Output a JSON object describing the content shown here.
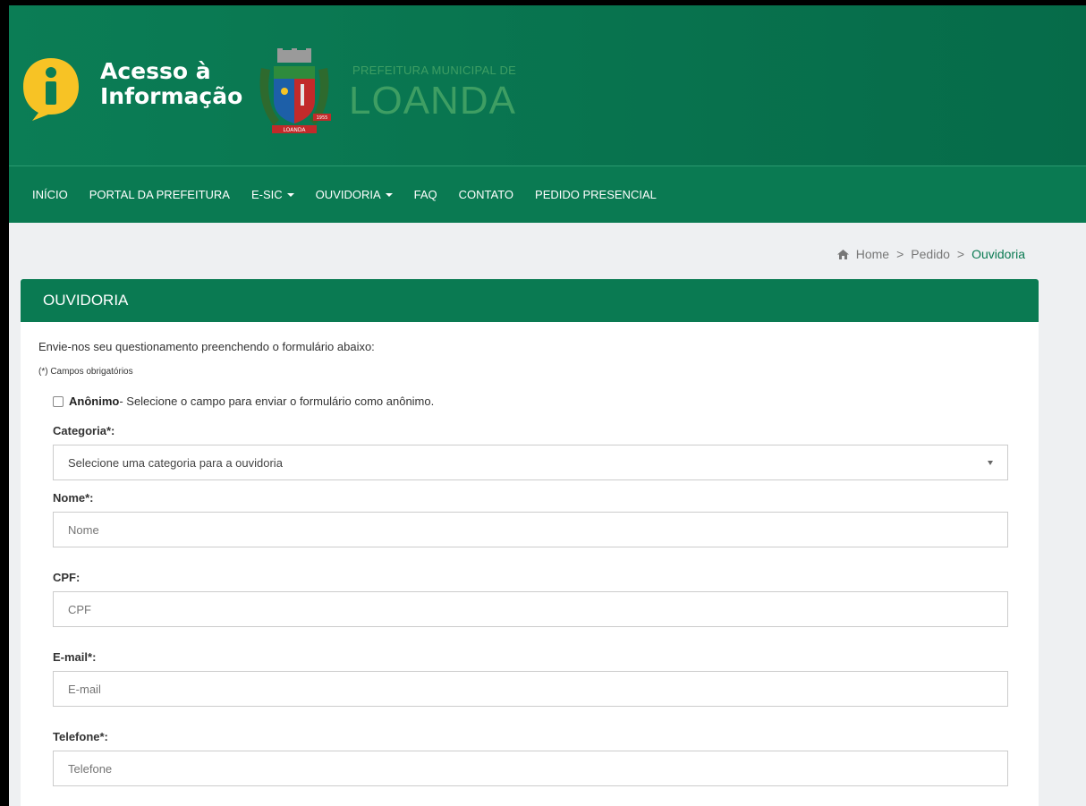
{
  "header": {
    "brand_line1": "Acesso à",
    "brand_line2": "Informação",
    "prefeitura_small": "PREFEITURA MUNICIPAL DE",
    "prefeitura_big": "LOANDA",
    "crest_text_bottom": "LOANDA",
    "crest_year": "1955"
  },
  "nav": {
    "items": [
      {
        "label": "INÍCIO"
      },
      {
        "label": "PORTAL DA PREFEITURA"
      },
      {
        "label": "E-SIC",
        "dropdown": true
      },
      {
        "label": "OUVIDORIA",
        "dropdown": true
      },
      {
        "label": "FAQ"
      },
      {
        "label": "CONTATO"
      },
      {
        "label": "PEDIDO PRESENCIAL"
      }
    ]
  },
  "breadcrumb": {
    "home": "Home",
    "pedido": "Pedido",
    "current": "Ouvidoria",
    "separator": ">"
  },
  "panel": {
    "title": "OUVIDORIA",
    "intro": "Envie-nos seu questionamento preenchendo o formulário abaixo:",
    "required_note": "(*) Campos obrigatórios",
    "anon_label": "Anônimo",
    "anon_desc": " - Selecione o campo para enviar o formulário como anônimo."
  },
  "form": {
    "categoria_label": "Categoria*:",
    "categoria_selected": "Selecione uma categoria para a ouvidoria",
    "nome_label": "Nome*:",
    "nome_placeholder": "Nome",
    "cpf_label": "CPF:",
    "cpf_placeholder": "CPF",
    "email_label": "E-mail*:",
    "email_placeholder": "E-mail",
    "telefone_label": "Telefone*:",
    "telefone_placeholder": "Telefone"
  },
  "colors": {
    "primary_green": "#0a7a52",
    "badge_yellow": "#f7c325"
  }
}
